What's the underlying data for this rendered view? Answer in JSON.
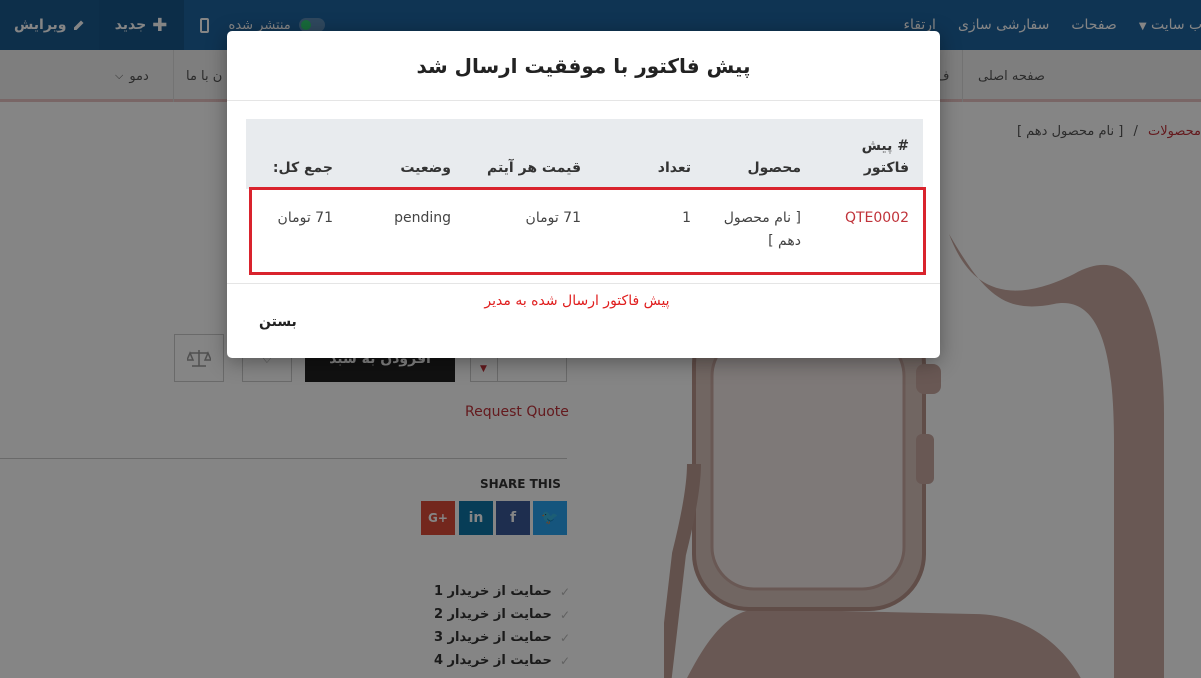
{
  "topbar": {
    "edit_label": "ویرایش",
    "new_label": "جدید",
    "publish_label": "منتشر شده",
    "menu": [
      "وب سایت",
      "صفحات",
      "سفارشی سازی",
      "ارتقاء"
    ]
  },
  "nav": {
    "home": "صفحه اصلی",
    "contact": "ن با ما",
    "demo": "دمو",
    "partial": "ف"
  },
  "breadcrumb": {
    "products": "محصولات",
    "separator": "/",
    "current": "[ نام محصول دهم ]"
  },
  "product": {
    "add_to_cart": "افزودن به سبد",
    "request_quote": "Request Quote",
    "share_title": "SHARE THIS",
    "support_items": [
      "حمایت از خریدار 1",
      "حمایت از خریدار 2",
      "حمایت از خریدار 3",
      "حمایت از خریدار 4"
    ]
  },
  "modal": {
    "title": "پیش فاکتور با موفقیت ارسال شد",
    "columns": {
      "quote_no": "# پیش فاکتور",
      "product": "محصول",
      "qty": "تعداد",
      "unit_price": "قیمت هر آیتم",
      "status": "وضعیت",
      "total": "جمع کل:"
    },
    "row": {
      "quote_no": "QTE0002",
      "product": "[ نام محصول دهم ]",
      "qty": "1",
      "unit_price": "71 تومان",
      "status": "pending",
      "total": "71 تومان"
    },
    "footer_message": "پیش فاکتور ارسال شده به مدیر",
    "close_label": "بستن"
  },
  "colors": {
    "topbar": "#1e64a0",
    "accent_red": "#c0333a",
    "highlight_red": "#d9232d"
  }
}
